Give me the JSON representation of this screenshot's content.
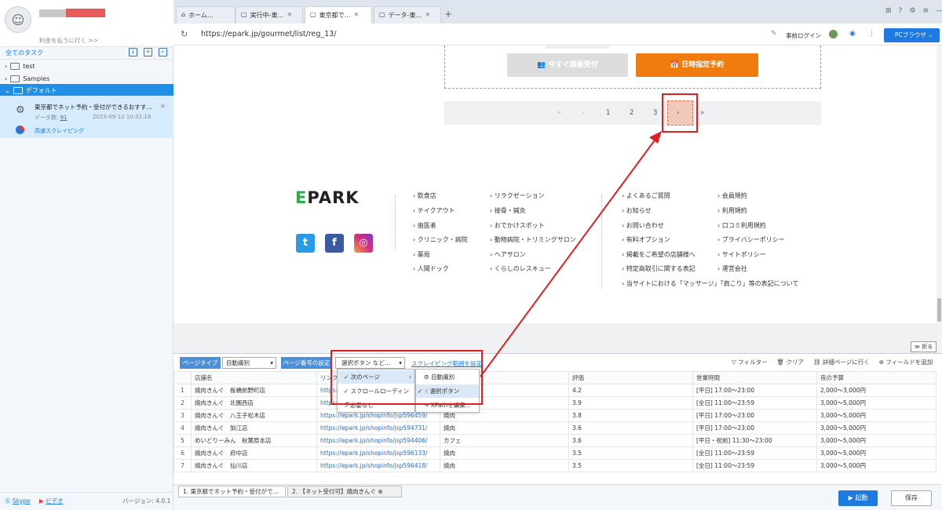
{
  "sidebar": {
    "pay_link": "料金を払うに行く >>",
    "all_tasks": "全てのタスク",
    "tree": [
      {
        "label": "test"
      },
      {
        "label": "Samples"
      },
      {
        "label": "デフォルト"
      }
    ],
    "task": {
      "title": "東京都でネット予約・受付ができるおすす…",
      "data_count_label": "データ数:",
      "data_count": "91",
      "date": "2023-09-12 10:32:18",
      "fast_scrape": "高速スクレイピング"
    },
    "footer": {
      "skype": "Skype",
      "video": "ビデオ",
      "version": "バージョン: 4.0.1"
    }
  },
  "tabs": [
    {
      "label": "ホーム…"
    },
    {
      "label": "実行中-東…"
    },
    {
      "label": "東京都で…"
    },
    {
      "label": "データ-東…"
    }
  ],
  "url_bar": {
    "url": "https://epark.jp/gourmet/list/reg_13/",
    "pre_login": "事前ログイン",
    "browser": "PCブラウザ"
  },
  "web": {
    "reserve_now": "今すぐ順番受付",
    "reserve_date": "日時指定予約",
    "pager": [
      "«",
      "‹",
      "1",
      "2",
      "3",
      "›",
      "»"
    ],
    "logo_e": "E",
    "logo_rest": "PARK",
    "footer_col1": [
      "飲食店",
      "テイクアウト",
      "歯医者",
      "クリニック・病院",
      "薬局",
      "人間ドック"
    ],
    "footer_col2": [
      "リラクゼーション",
      "接骨・鍼灸",
      "おでかけスポット",
      "動物病院・トリミングサロン",
      "ヘアサロン",
      "くらしのレスキュー"
    ],
    "footer_col3": [
      "よくあるご質問",
      "お知らせ",
      "お問い合わせ",
      "有料オプション",
      "掲載をご希望の店舗様へ",
      "特定商取引に関する表記",
      "当サイトにおける「マッサージ」「肩こり」等の表記について"
    ],
    "footer_col4": [
      "会員規約",
      "利用規約",
      "口コミ利用規約",
      "プライバシーポリシー",
      "サイトポリシー",
      "運営会社"
    ]
  },
  "panel": {
    "collapse": "折る",
    "page_type": "ページタイプ",
    "page_type_value": "自動識別",
    "page_num_setting": "ページ番号の設定",
    "select_btn": "選択ボタン など…",
    "scrape_range": "スクレイピング範囲を設定",
    "filter": "フィルター",
    "clear": "クリア",
    "detail": "詳細ページに行く",
    "add_field": "フィールドを追加",
    "menu1": [
      "次のページ",
      "スクロールローディング",
      "必要なし"
    ],
    "menu2": [
      "自動識別",
      "選択ボタン",
      "XPathを編集…"
    ],
    "columns": [
      "",
      "店舗名",
      "リンク",
      "",
      "評価",
      "営業時間",
      "夜の予算"
    ],
    "rows": [
      [
        "1",
        "焼肉きんぐ　板橋前野町店",
        "https://epark.jp/shopinfo/jsp596459/",
        "焼肉",
        "4.2",
        "[平日] 17:00～23:00",
        "2,000～3,000円"
      ],
      [
        "2",
        "焼肉きんぐ　北園西店",
        "https://epark.jp/shopinfo/jsp596452/",
        "焼肉",
        "3.9",
        "[全日] 11:00～23:59",
        "3,000～5,000円"
      ],
      [
        "3",
        "焼肉きんぐ　八王子松木店",
        "https://epark.jp/shopinfo/jsp596459/",
        "焼肉",
        "3.8",
        "[平日] 17:00～23:00",
        "3,000～5,000円"
      ],
      [
        "4",
        "焼肉きんぐ　狛江店",
        "https://epark.jp/shopinfo/jsp594731/",
        "焼肉",
        "3.6",
        "[平日] 17:00～23:00",
        "3,000～5,000円"
      ],
      [
        "5",
        "めいどりーみん　秋葉原本店",
        "https://epark.jp/shopinfo/jsp594406/",
        "カフェ",
        "3.6",
        "[平日・祝前] 11:30～23:00",
        "3,000～5,000円"
      ],
      [
        "6",
        "焼肉きんぐ　府中店",
        "https://epark.jp/shopinfo/jsp596133/",
        "焼肉",
        "3.5",
        "[全日] 11:00～23:59",
        "3,000～5,000円"
      ],
      [
        "7",
        "焼肉きんぐ　仙川店",
        "https://epark.jp/shopinfo/jsp596418/",
        "焼肉",
        "3.5",
        "[全日] 11:00～23:59",
        "3,000～5,000円"
      ]
    ]
  },
  "footer": {
    "tabs": [
      "1. 東京都でネット予約・受付がで…",
      "2. 【ネット受付可】焼肉きんぐ"
    ],
    "start": "起動",
    "save": "保存"
  },
  "colors": {
    "accent": "#1f7ae0",
    "orange": "#f07c10",
    "highlight_red": "#e02020"
  }
}
